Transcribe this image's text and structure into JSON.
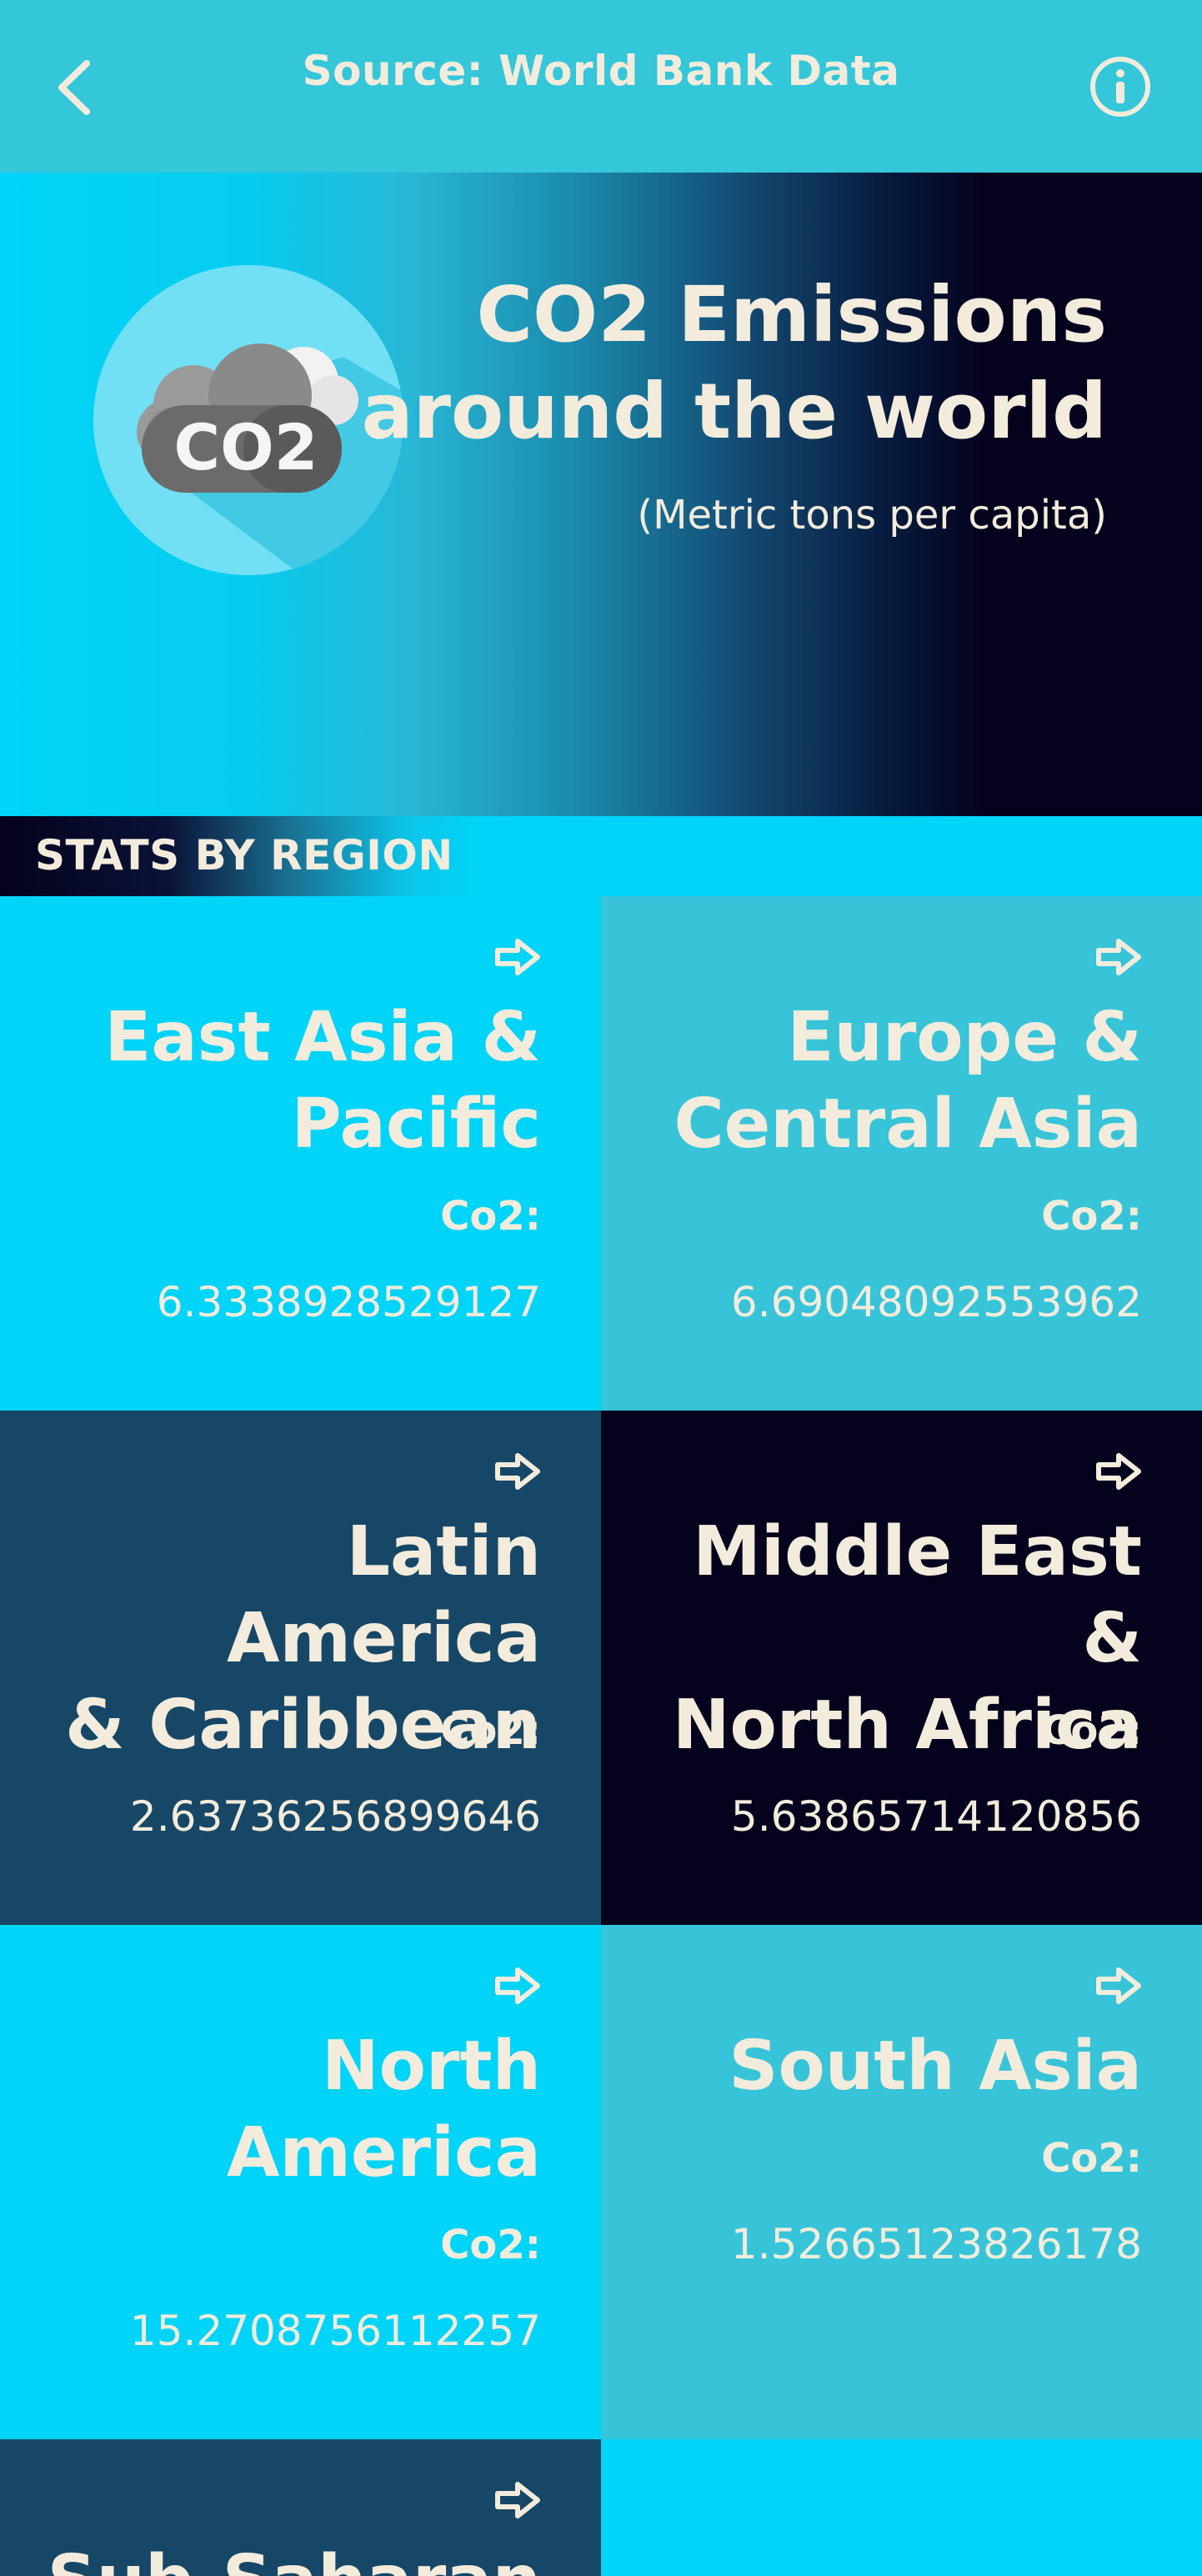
{
  "header": {
    "title": "Source: World Bank Data",
    "back_icon": "chevron-left-icon",
    "info_icon": "info-icon"
  },
  "hero": {
    "logo_text": "CO2",
    "title_line1": "CO2 Emissions",
    "title_line2": "around the world",
    "subtitle": "(Metric tons per capita)"
  },
  "section": {
    "title": "STATS BY REGION"
  },
  "regions": [
    {
      "line1": "East Asia &",
      "line2": "Pacific",
      "label": "Co2:",
      "value": "6.3338928529127"
    },
    {
      "line1": "Europe &",
      "line2": "Central Asia",
      "label": "Co2:",
      "value": "6.69048092553962"
    },
    {
      "line1": "Latin America",
      "line2": "& Caribbean",
      "label": "Co2:",
      "value": "2.63736256899646"
    },
    {
      "line1": "Middle East &",
      "line2": "North Africa",
      "label": "Co2:",
      "value": "5.63865714120856"
    },
    {
      "line1": "North",
      "line2": "America",
      "label": "Co2:",
      "value": "15.2708756112257"
    },
    {
      "line1": "South Asia",
      "line2": "",
      "label": "Co2:",
      "value": "1.52665123826178"
    },
    {
      "line1": "Sub-Saharan",
      "line2": "",
      "label": "",
      "value": ""
    }
  ],
  "colors": {
    "cyan": "#00d4f8",
    "teal": "#37c4d8",
    "navy": "#174766",
    "dark": "#04021d",
    "text": "#f3ecdc"
  }
}
